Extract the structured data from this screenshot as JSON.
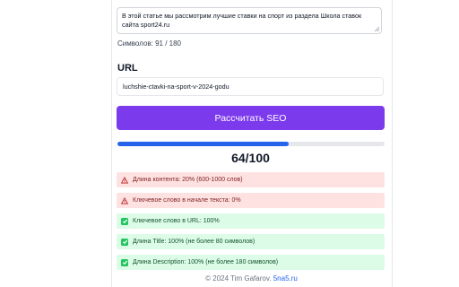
{
  "description": {
    "value": "В этой статье мы рассмотрим лучшие ставки на спорт из раздела Школа ставок сайта sport24.ru"
  },
  "counter": {
    "label": "Символов: 91 / 180"
  },
  "url": {
    "label": "URL",
    "value": "luchshie-ctavki-na-sport-v-2024-godu"
  },
  "action": {
    "label": "Рассчитать SEO"
  },
  "score": {
    "value": 64,
    "text": "64/100",
    "bar_color": "#2563eb"
  },
  "results": [
    {
      "status": "bad",
      "icon": "warning-icon",
      "text": "Длина контента: 20% (600-1000 слов)"
    },
    {
      "status": "bad",
      "icon": "warning-icon",
      "text": "Ключевое слово в начале текста: 0%"
    },
    {
      "status": "good",
      "icon": "check-icon",
      "text": "Ключевое слово в URL: 100%"
    },
    {
      "status": "good",
      "icon": "check-icon",
      "text": "Длина Title: 100% (не более 80 символов)"
    },
    {
      "status": "good",
      "icon": "check-icon",
      "text": "Длина Description: 100% (не более 180 символов)"
    }
  ],
  "footer": {
    "copyright": "© 2024 Tim Gafarov.",
    "link": "5na5.ru"
  },
  "colors": {
    "primary": "#7c3aed",
    "bad_bg": "#fee2e2",
    "good_bg": "#dcfce7"
  }
}
